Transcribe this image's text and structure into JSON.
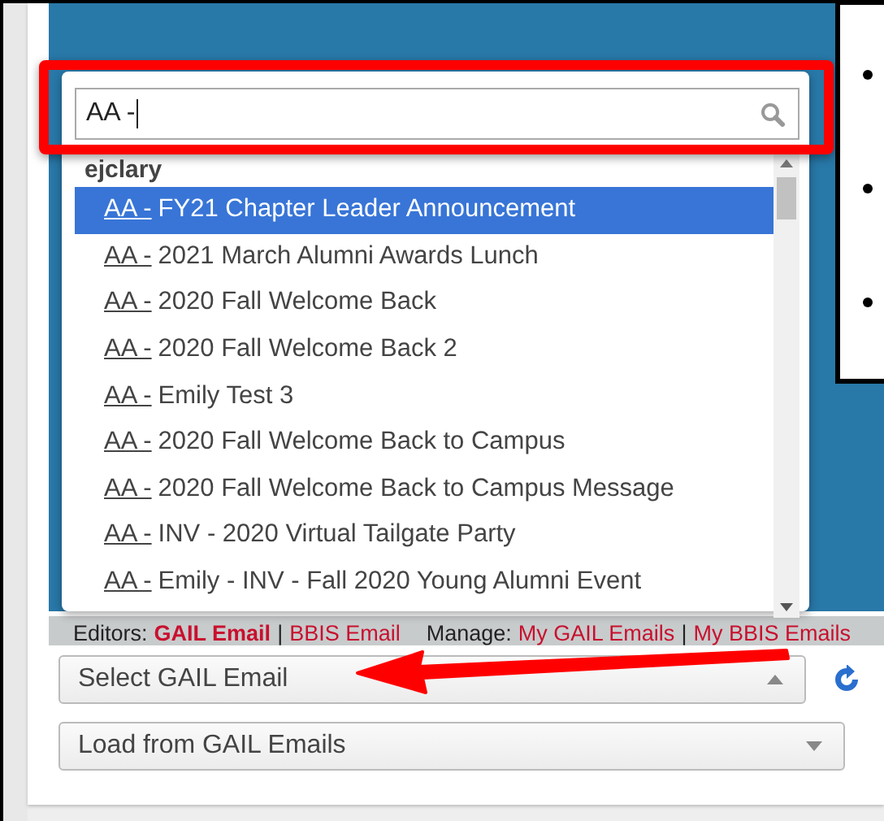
{
  "search": {
    "value": "AA - "
  },
  "dropdown": {
    "group": "ejclary",
    "items": [
      {
        "prefix": "AA -",
        "title": "FY21 Chapter Leader Announcement",
        "selected": true
      },
      {
        "prefix": "AA -",
        "title": "2021 March Alumni Awards Lunch",
        "selected": false
      },
      {
        "prefix": "AA -",
        "title": "2020 Fall Welcome Back",
        "selected": false
      },
      {
        "prefix": "AA -",
        "title": "2020 Fall Welcome Back 2",
        "selected": false
      },
      {
        "prefix": "AA -",
        "title": "Emily Test 3",
        "selected": false
      },
      {
        "prefix": "AA -",
        "title": "2020 Fall Welcome Back to Campus",
        "selected": false
      },
      {
        "prefix": "AA -",
        "title": "2020 Fall Welcome Back to Campus Message",
        "selected": false
      },
      {
        "prefix": "AA -",
        "title": "INV - 2020 Virtual Tailgate Party",
        "selected": false
      },
      {
        "prefix": "AA -",
        "title": "Emily - INV - Fall 2020 Young Alumni Event",
        "selected": false
      }
    ]
  },
  "links_bar": {
    "separator": "|",
    "editors_label": "Editors:",
    "editors": [
      {
        "label": "GAIL Email",
        "active": true
      },
      {
        "label": "BBIS Email",
        "active": false
      }
    ],
    "manage_label": "Manage:",
    "manage": [
      {
        "label": "My GAIL Emails",
        "active": false
      },
      {
        "label": "My BBIS Emails",
        "active": false
      }
    ]
  },
  "selects": [
    {
      "text": "Select GAIL Email",
      "expanded": true,
      "refresh": true
    },
    {
      "text": "Load from GAIL Emails",
      "expanded": false,
      "refresh": false
    }
  ]
}
